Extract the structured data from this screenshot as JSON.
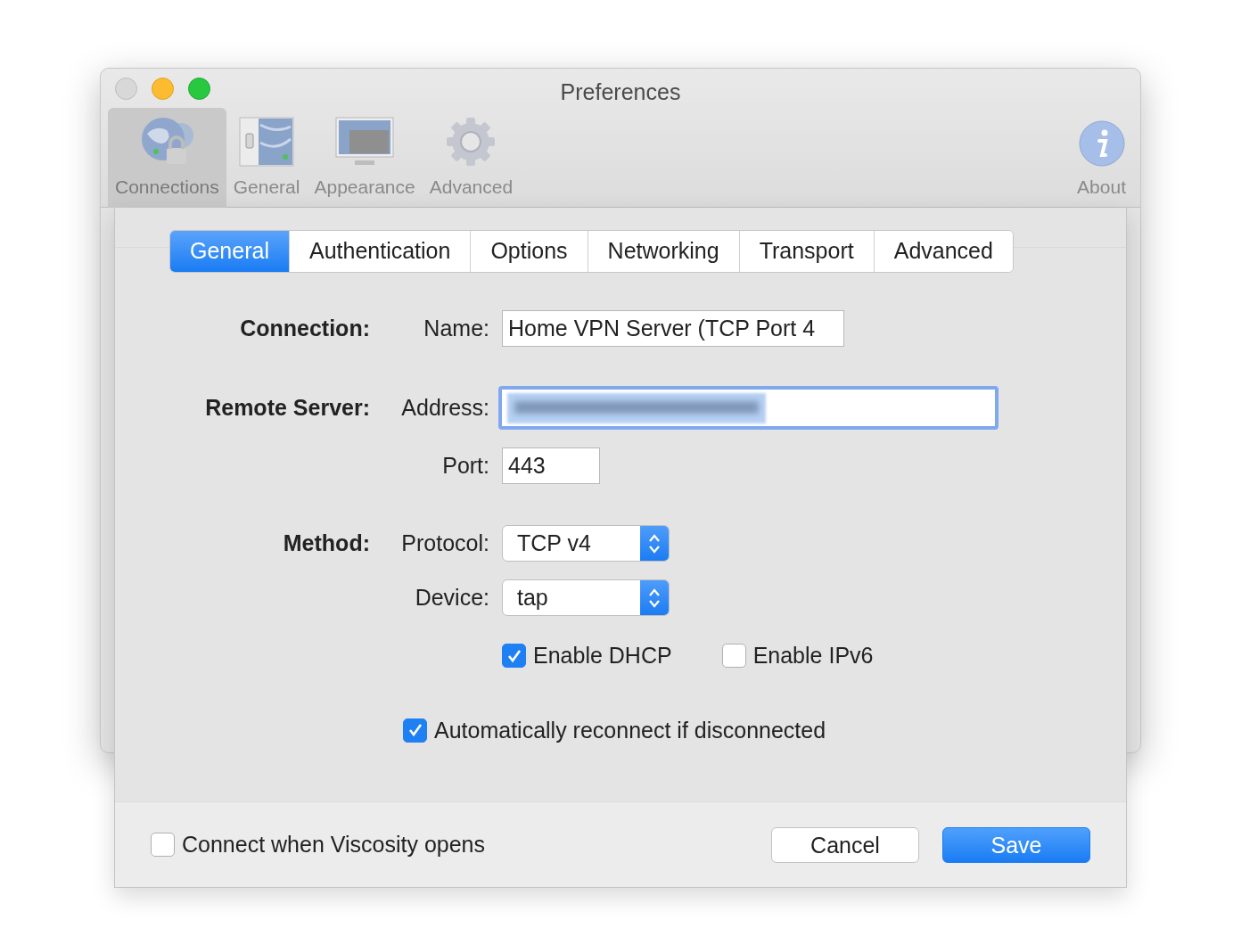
{
  "window": {
    "title": "Preferences"
  },
  "toolbar": [
    {
      "label": "Connections",
      "kind": "globe",
      "selected": true
    },
    {
      "label": "General",
      "kind": "switch",
      "selected": false
    },
    {
      "label": "Appearance",
      "kind": "monitor",
      "selected": false
    },
    {
      "label": "Advanced",
      "kind": "gear",
      "selected": false
    },
    {
      "label": "About",
      "kind": "info",
      "selected": false
    }
  ],
  "tabs": [
    {
      "label": "General",
      "selected": true
    },
    {
      "label": "Authentication",
      "selected": false
    },
    {
      "label": "Options",
      "selected": false
    },
    {
      "label": "Networking",
      "selected": false
    },
    {
      "label": "Transport",
      "selected": false
    },
    {
      "label": "Advanced",
      "selected": false
    }
  ],
  "sections": [
    {
      "heading": "Connection:",
      "rows": [
        {
          "kind": "text",
          "label": "Name:",
          "value": "Home VPN Server (TCP Port 4"
        }
      ]
    },
    {
      "heading": "Remote Server:",
      "rows": [
        {
          "kind": "text",
          "label": "Address:",
          "focused": true,
          "value_blurred": true
        },
        {
          "kind": "text",
          "label": "Port:",
          "value": "443"
        }
      ]
    },
    {
      "heading": "Method:",
      "rows": [
        {
          "kind": "popup",
          "label": "Protocol:",
          "value": "TCP v4"
        },
        {
          "kind": "popup",
          "label": "Device:",
          "value": "tap"
        }
      ]
    }
  ],
  "options": [
    {
      "label": "Enable DHCP",
      "checked": true
    },
    {
      "label": "Enable IPv6",
      "checked": false
    }
  ],
  "auto_reconnect": {
    "label": "Automatically reconnect if disconnected",
    "checked": true
  },
  "footer": {
    "checkbox": {
      "label": "Connect when Viscosity opens",
      "checked": false
    },
    "buttons": [
      {
        "label": "Cancel",
        "kind": "default"
      },
      {
        "label": "Save",
        "kind": "primary"
      }
    ]
  }
}
